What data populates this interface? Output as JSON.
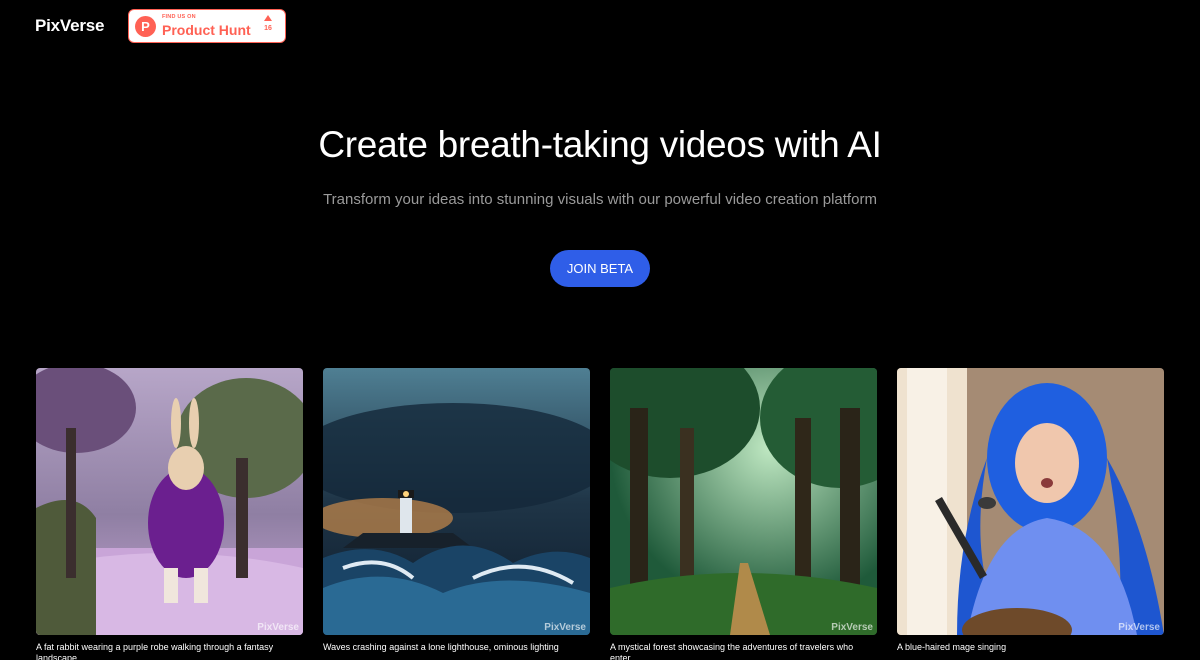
{
  "header": {
    "logo": "PixVerse",
    "product_hunt": {
      "small_text": "FIND US ON",
      "big_text": "Product Hunt",
      "logo_letter": "P",
      "upvotes": "16"
    }
  },
  "hero": {
    "title": "Create breath-taking videos with AI",
    "subtitle": "Transform your ideas into stunning visuals with our powerful video creation platform",
    "cta_label": "JOIN BETA"
  },
  "gallery": {
    "watermark": "PixVerse",
    "items": [
      {
        "caption": "A fat rabbit wearing a purple robe walking through a fantasy landscape"
      },
      {
        "caption": "Waves crashing against a lone lighthouse, ominous lighting"
      },
      {
        "caption": "A mystical forest showcasing the adventures of travelers who enter"
      },
      {
        "caption": "A blue-haired mage singing"
      }
    ]
  },
  "colors": {
    "background": "#000000",
    "accent": "#2f5ee8",
    "product_hunt": "#ff6154"
  }
}
